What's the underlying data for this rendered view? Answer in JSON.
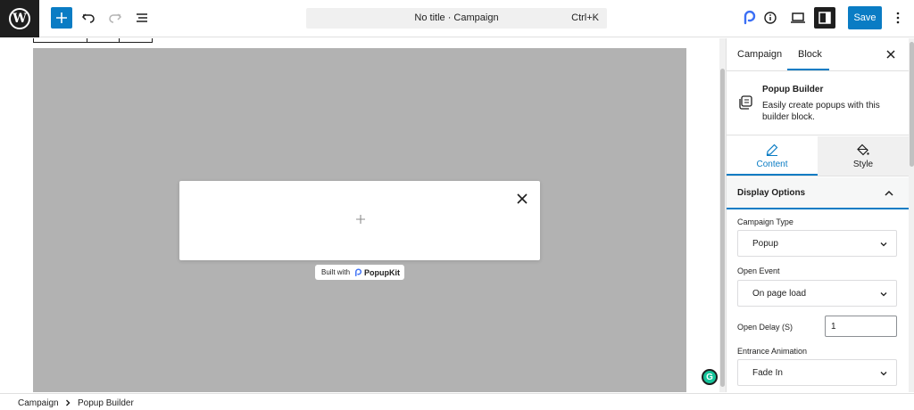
{
  "header": {
    "doc_title": "No title · Campaign",
    "shortcut": "Ctrl+K",
    "save_label": "Save"
  },
  "canvas": {
    "built_with_label": "Built with",
    "built_with_brand": "PopupKit",
    "grammarly_letter": "G"
  },
  "sidebar": {
    "tabs": [
      {
        "label": "Campaign",
        "active": false
      },
      {
        "label": "Block",
        "active": true
      }
    ],
    "block": {
      "title": "Popup Builder",
      "description": "Easily create popups with this builder block."
    },
    "content_tabs": [
      {
        "label": "Content",
        "active": true
      },
      {
        "label": "Style",
        "active": false
      }
    ],
    "panel": {
      "title": "Display Options",
      "fields": {
        "campaign_type": {
          "label": "Campaign Type",
          "value": "Popup"
        },
        "open_event": {
          "label": "Open Event",
          "value": "On page load"
        },
        "open_delay": {
          "label": "Open Delay (S)",
          "value": "1"
        },
        "entrance_animation": {
          "label": "Entrance Animation",
          "value": "Fade In"
        }
      }
    }
  },
  "breadcrumb": [
    "Campaign",
    "Popup Builder"
  ],
  "colors": {
    "accent": "#0a7cc4",
    "overlay": "#b2b2b2",
    "dark": "#1e1e1e"
  }
}
